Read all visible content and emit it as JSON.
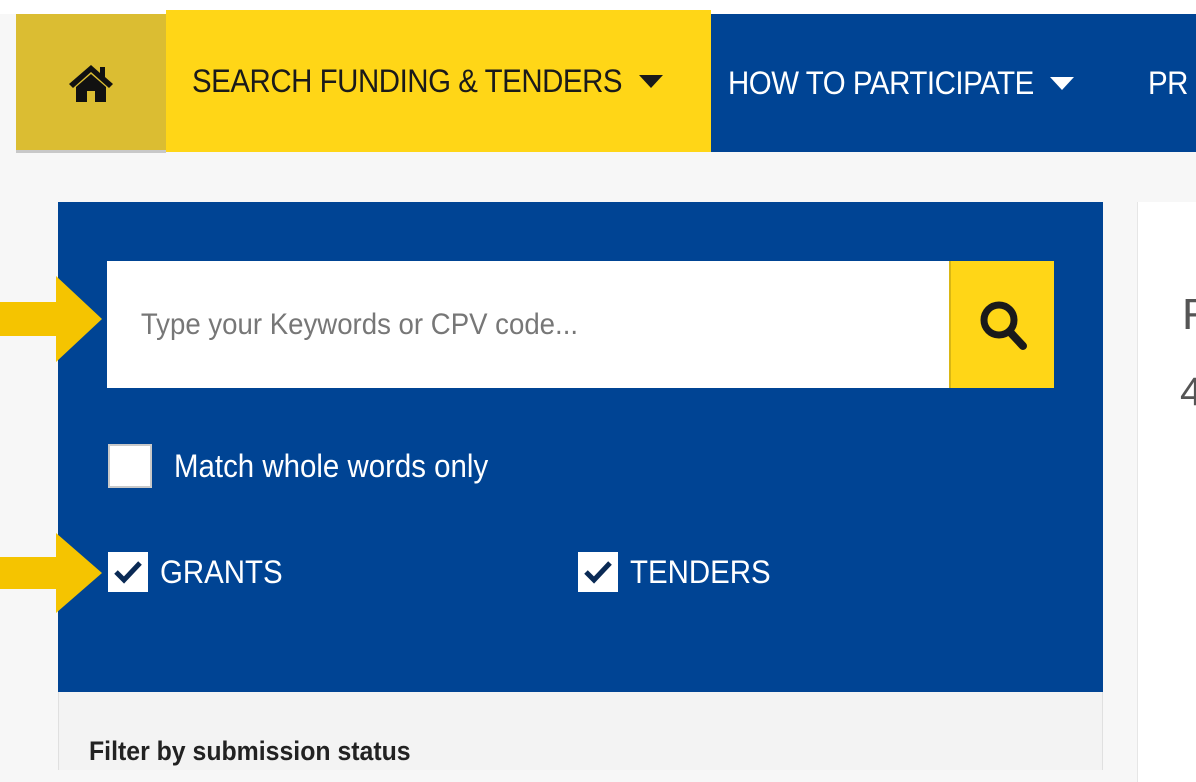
{
  "nav": {
    "home_icon": "home-icon",
    "items": [
      {
        "label": "SEARCH FUNDING & TENDERS",
        "active": true
      },
      {
        "label": "HOW TO PARTICIPATE",
        "active": false
      },
      {
        "label": "PR",
        "active": false
      }
    ]
  },
  "search": {
    "placeholder": "Type your Keywords or CPV code...",
    "value": "",
    "button_icon": "search-icon"
  },
  "options": {
    "match_whole_words": {
      "label": "Match whole words only",
      "checked": false
    },
    "grants": {
      "label": "GRANTS",
      "checked": true
    },
    "tenders": {
      "label": "TENDERS",
      "checked": true
    }
  },
  "filter": {
    "title": "Filter by submission status"
  },
  "results": {
    "partial_text_1": "R",
    "partial_text_2": "4"
  },
  "colors": {
    "eu_blue": "#004494",
    "eu_yellow": "#ffd617",
    "annotation_arrow": "#f5c400"
  }
}
